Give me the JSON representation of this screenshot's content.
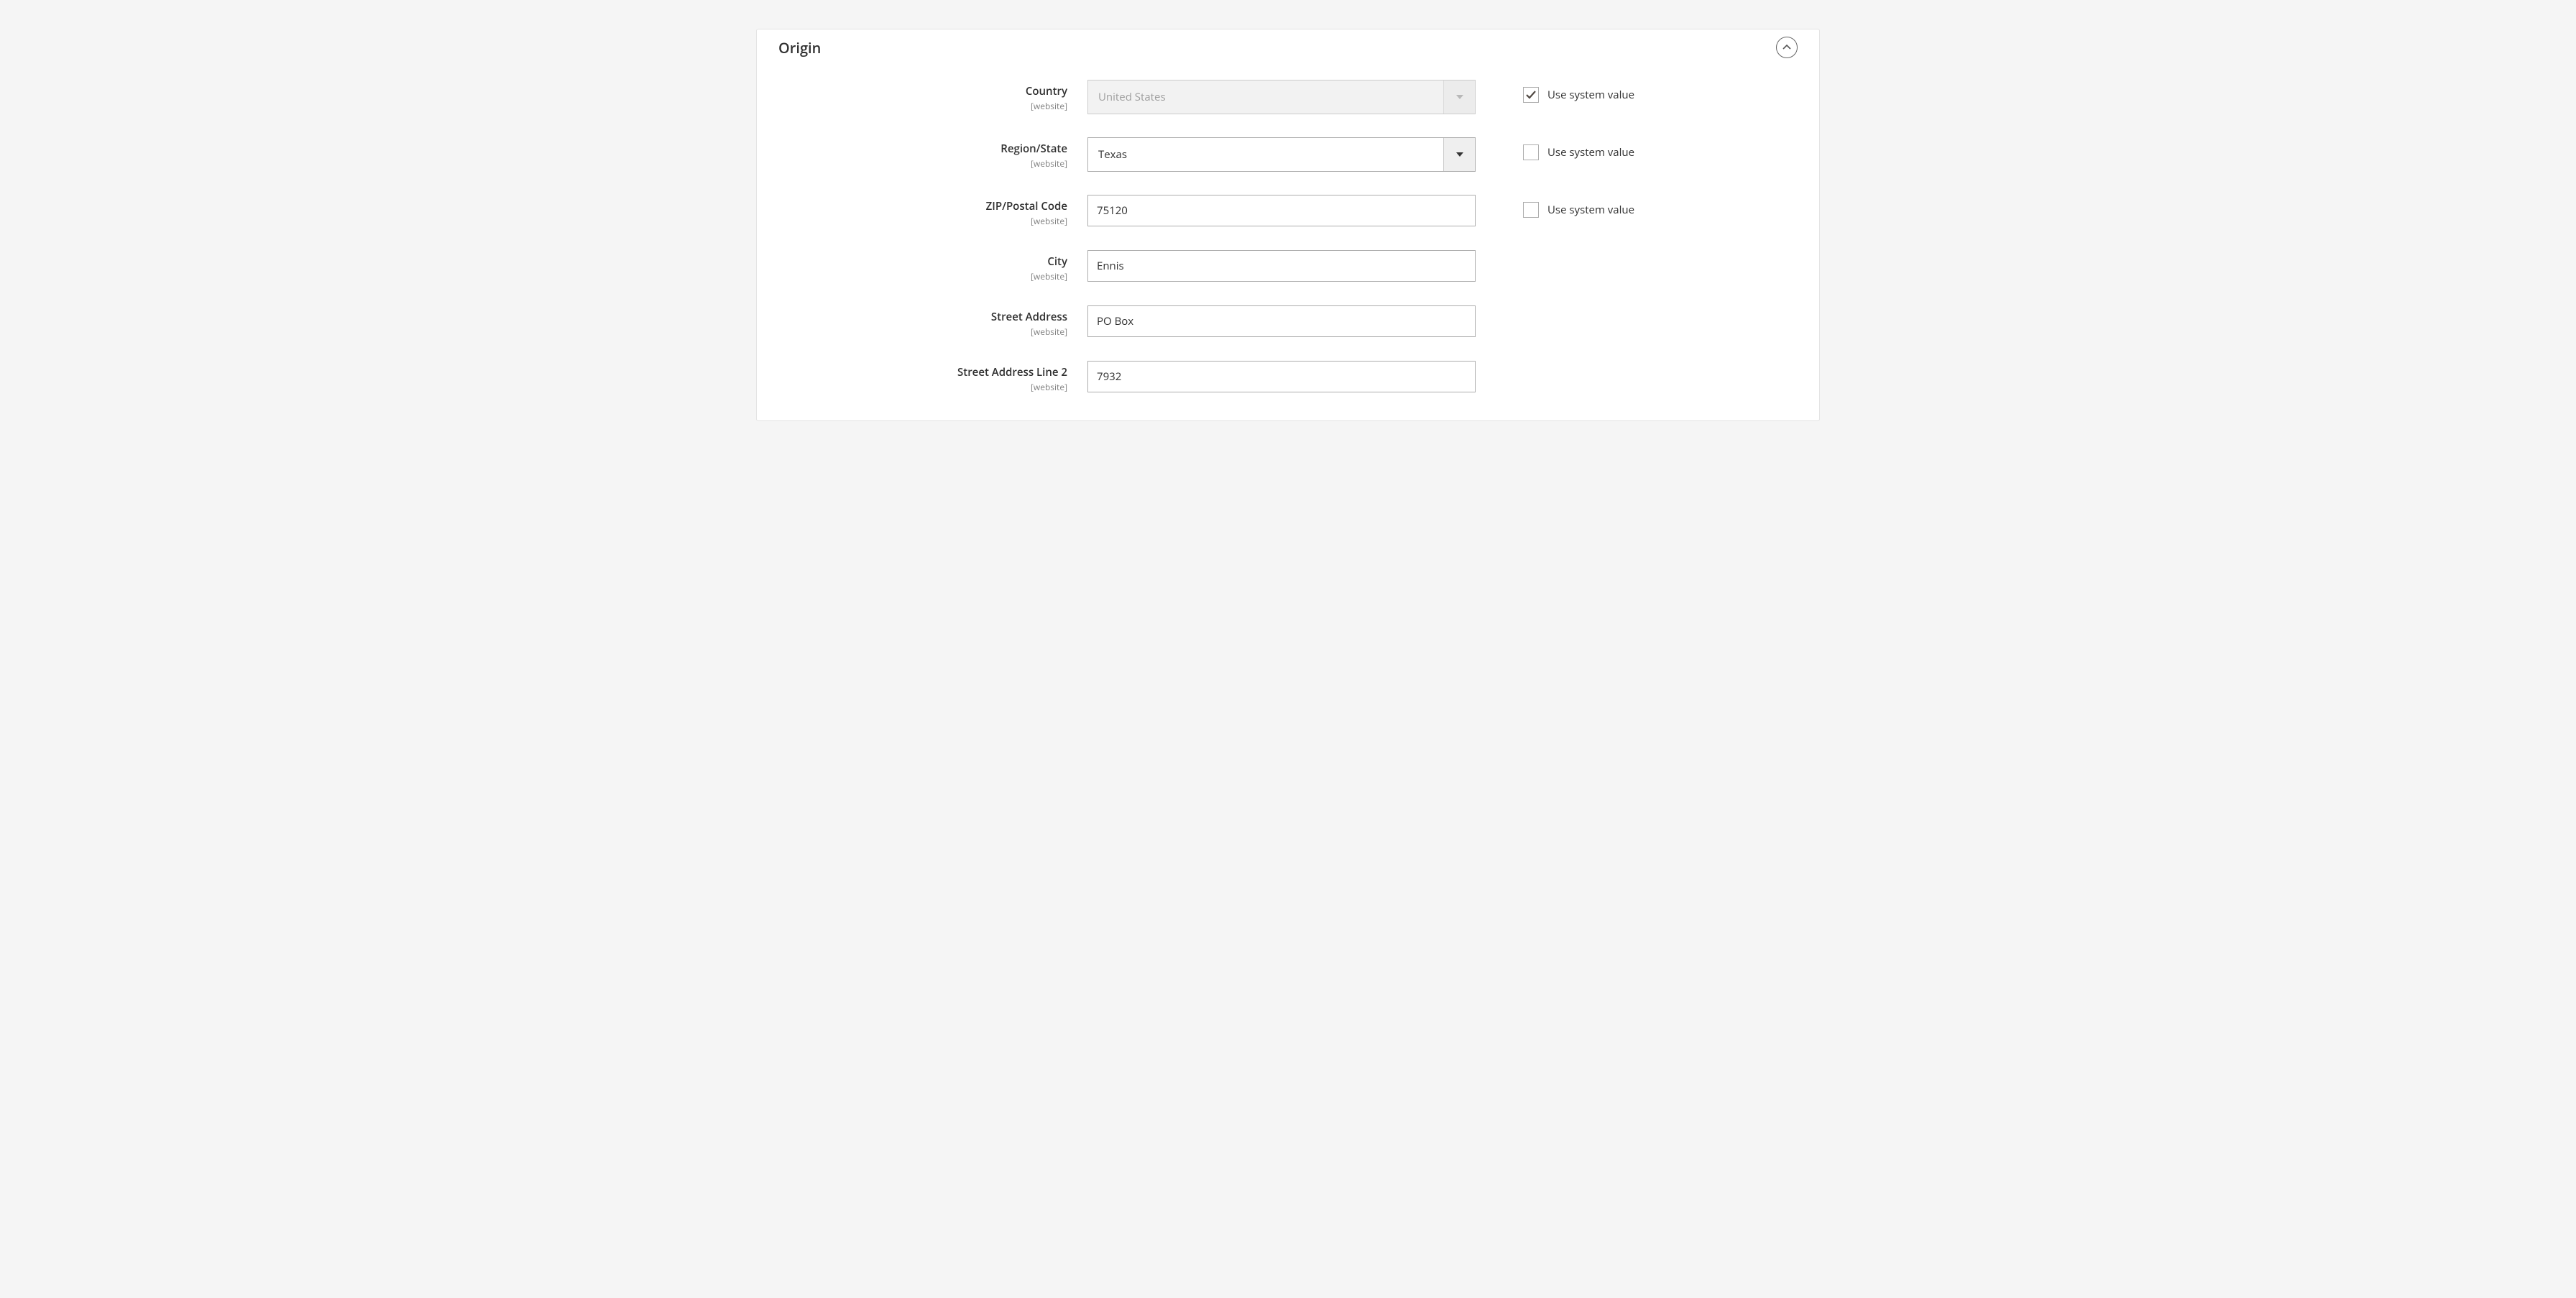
{
  "panel": {
    "title": "Origin"
  },
  "scope_label": "[website]",
  "use_system_value_label": "Use system value",
  "fields": {
    "country": {
      "label": "Country",
      "value": "United States",
      "use_system": true
    },
    "region": {
      "label": "Region/State",
      "value": "Texas",
      "use_system": false
    },
    "zip": {
      "label": "ZIP/Postal Code",
      "value": "75120",
      "use_system": false
    },
    "city": {
      "label": "City",
      "value": "Ennis"
    },
    "street1": {
      "label": "Street Address",
      "value": "PO Box"
    },
    "street2": {
      "label": "Street Address Line 2",
      "value": "7932"
    }
  }
}
